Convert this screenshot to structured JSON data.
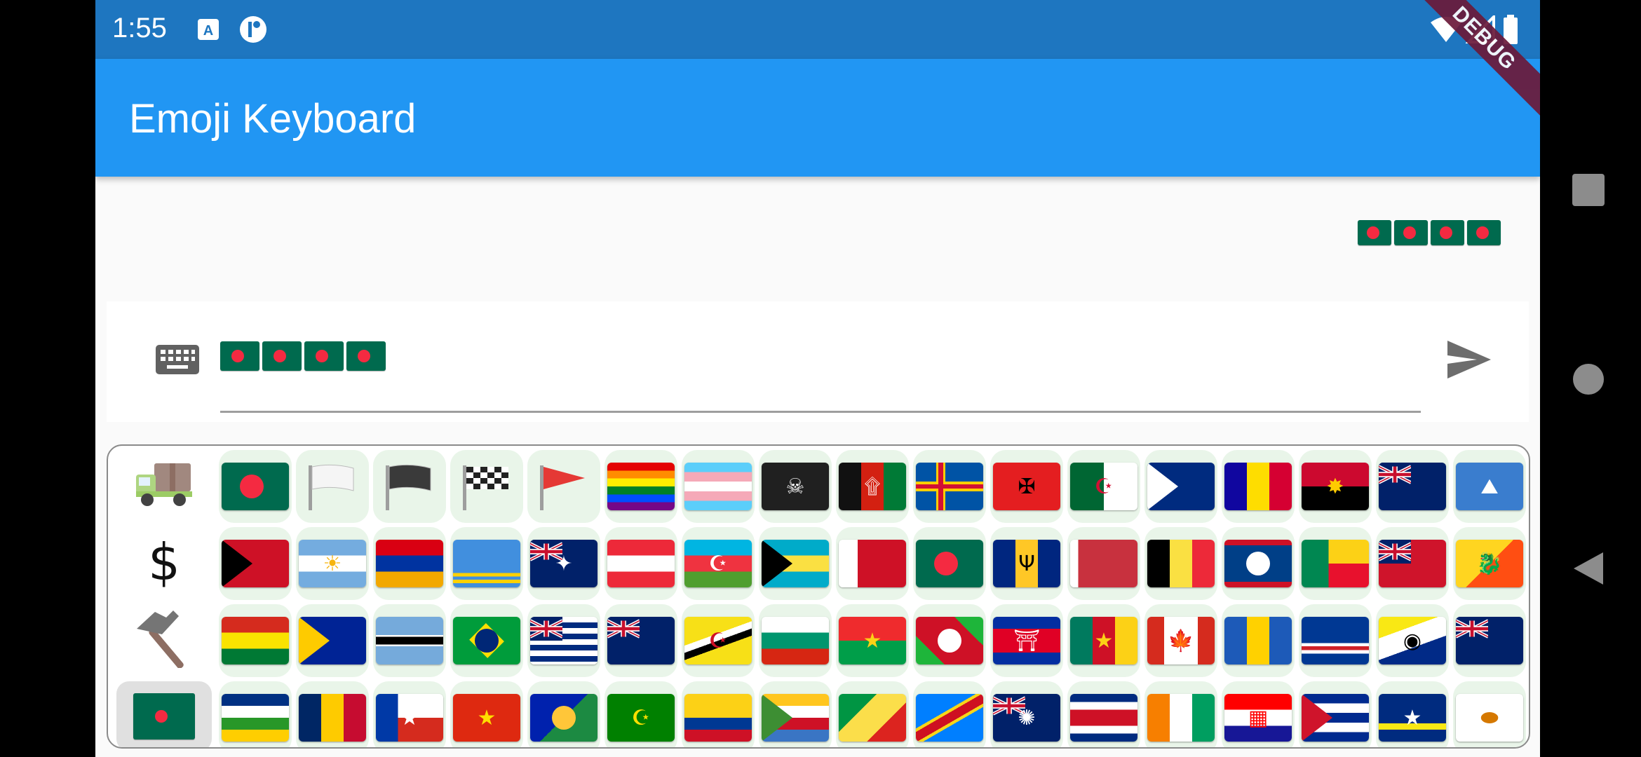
{
  "status_bar": {
    "time": "1:55",
    "notif_icons": [
      "a-notification-icon",
      "circle-p-notification-icon"
    ],
    "system_icons": [
      "wifi-icon",
      "signal-icon",
      "battery-icon"
    ]
  },
  "app_bar": {
    "title": "Emoji Keyboard",
    "debug_banner": "DEBUG",
    "color": "#2196f3"
  },
  "message": {
    "sent_text": "🇧🇩🇧🇩🇧🇩🇧🇩",
    "sent_flags": [
      "Bangladesh",
      "Bangladesh",
      "Bangladesh",
      "Bangladesh"
    ]
  },
  "input": {
    "value": "🇧🇩🇧🇩🇧🇩🇧🇩",
    "value_flags": [
      "Bangladesh",
      "Bangladesh",
      "Bangladesh",
      "Bangladesh"
    ],
    "keyboard_icon": "keyboard-icon",
    "send_icon": "send-icon"
  },
  "categories": [
    {
      "name": "Travel",
      "icon": "truck-icon",
      "selected": false
    },
    {
      "name": "Symbols",
      "icon": "dollar-icon",
      "glyph": "$",
      "selected": false
    },
    {
      "name": "Objects",
      "icon": "hammer-icon",
      "selected": false
    },
    {
      "name": "Flags",
      "icon": "bangladesh-flag-icon",
      "selected": true
    }
  ],
  "emoji_grid": [
    [
      "Bangladesh",
      "White Flag",
      "Black Flag",
      "Chequered Flag",
      "Triangular Flag",
      "Rainbow Flag",
      "Transgender Flag",
      "Pirate Flag",
      "Afghanistan",
      "Åland Islands",
      "Albania",
      "Algeria",
      "American Samoa",
      "Andorra",
      "Angola",
      "Anguilla",
      "Antarctica"
    ],
    [
      "Antigua & Barbuda",
      "Argentina",
      "Armenia",
      "Aruba",
      "Australia",
      "Austria",
      "Azerbaijan",
      "Bahamas",
      "Bahrain",
      "Bangladesh",
      "Barbados",
      "Belarus",
      "Belgium",
      "Belize",
      "Benin",
      "Bermuda",
      "Bhutan"
    ],
    [
      "Bolivia",
      "Bosnia & Herzegovina",
      "Botswana",
      "Brazil",
      "British Indian Ocean Territory",
      "British Virgin Islands",
      "Brunei",
      "Bulgaria",
      "Burkina Faso",
      "Burundi",
      "Cambodia",
      "Cameroon",
      "Canada",
      "Curaçao Stripes",
      "Cape Verde",
      "Caribbean Netherlands",
      "Cayman Islands"
    ],
    [
      "Central African Republic",
      "Chad",
      "Chile",
      "China",
      "Christmas Island",
      "Cocos Islands",
      "Colombia",
      "Comoros",
      "Congo - Brazzaville",
      "Congo - Kinshasa",
      "Cook Islands",
      "Costa Rica",
      "Côte d’Ivoire",
      "Croatia",
      "Cuba",
      "Curaçao",
      "Cyprus"
    ]
  ],
  "nav": {
    "recents_icon": "square-icon",
    "home_icon": "circle-icon",
    "back_icon": "triangle-back-icon"
  }
}
